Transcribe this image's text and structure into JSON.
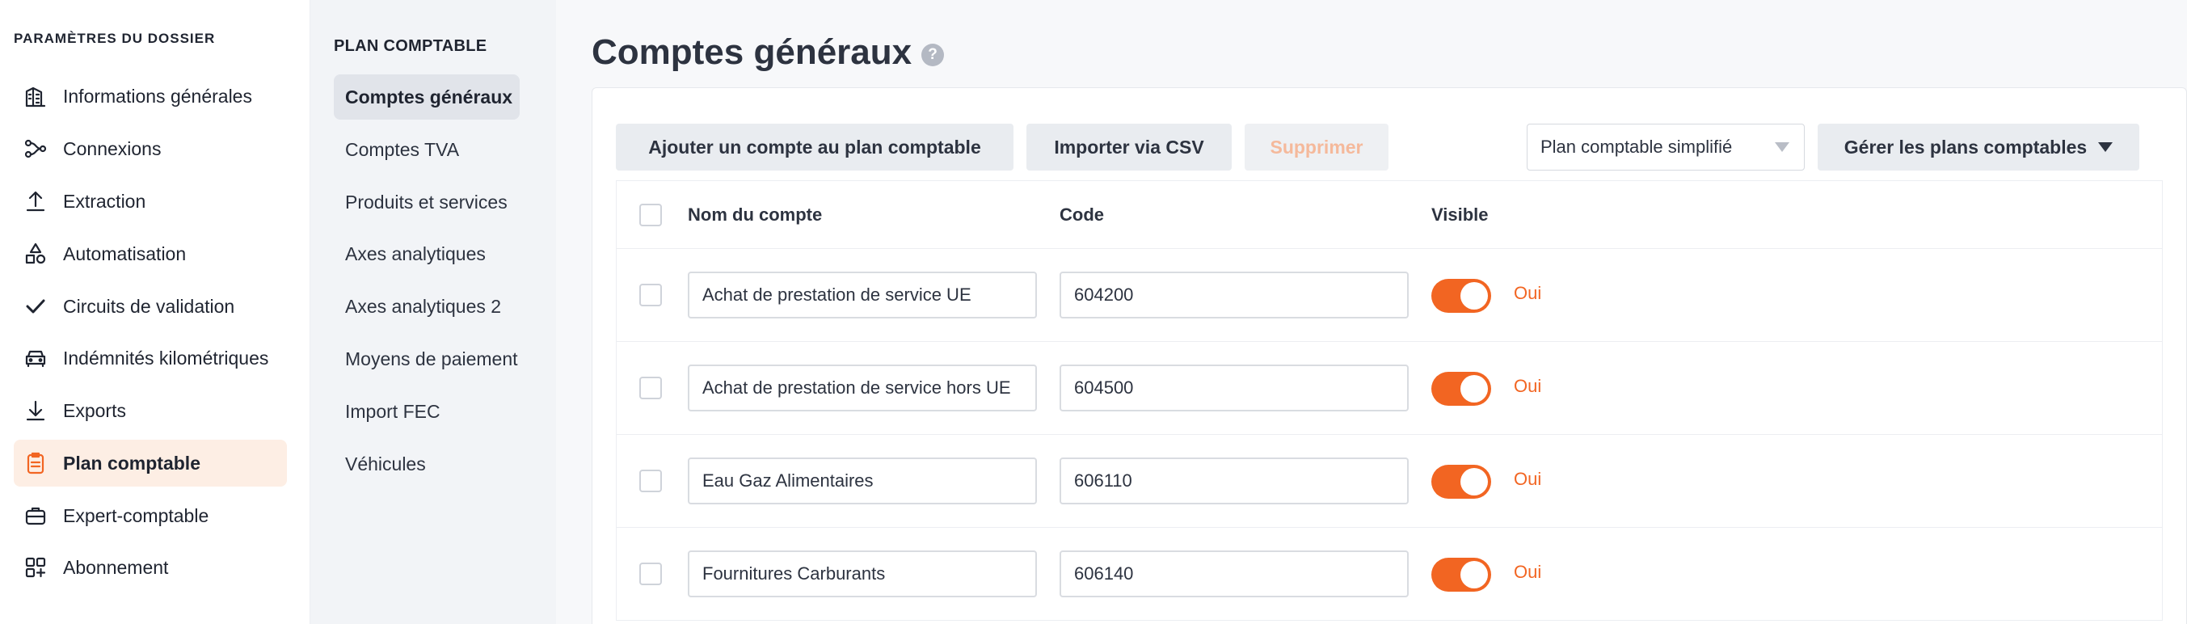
{
  "sidebar": {
    "title": "PARAMÈTRES DU DOSSIER",
    "items": [
      {
        "label": "Informations générales",
        "icon": "building-icon"
      },
      {
        "label": "Connexions",
        "icon": "connections-icon"
      },
      {
        "label": "Extraction",
        "icon": "upload-icon"
      },
      {
        "label": "Automatisation",
        "icon": "shapes-icon"
      },
      {
        "label": "Circuits de validation",
        "icon": "check-icon"
      },
      {
        "label": "Indémnités kilométriques",
        "icon": "car-icon"
      },
      {
        "label": "Exports",
        "icon": "download-icon"
      },
      {
        "label": "Plan comptable",
        "icon": "clipboard-icon",
        "active": true
      },
      {
        "label": "Expert-comptable",
        "icon": "briefcase-icon"
      },
      {
        "label": "Abonnement",
        "icon": "grid-plus-icon"
      }
    ]
  },
  "subnav": {
    "title": "PLAN COMPTABLE",
    "items": [
      {
        "label": "Comptes généraux",
        "active": true
      },
      {
        "label": "Comptes TVA"
      },
      {
        "label": "Produits et services"
      },
      {
        "label": "Axes analytiques"
      },
      {
        "label": "Axes analytiques 2"
      },
      {
        "label": "Moyens de paiement"
      },
      {
        "label": "Import FEC"
      },
      {
        "label": "Véhicules"
      }
    ]
  },
  "main": {
    "title": "Comptes généraux",
    "help": "?",
    "toolbar": {
      "add_label": "Ajouter un compte au plan comptable",
      "import_label": "Importer via CSV",
      "delete_label": "Supprimer",
      "plan_select_value": "Plan comptable simplifié",
      "manage_label": "Gérer les plans comptables"
    },
    "table": {
      "headers": {
        "name": "Nom du compte",
        "code": "Code",
        "visible": "Visible"
      },
      "rows": [
        {
          "name": "Achat de prestation de service UE",
          "code": "604200",
          "visible": "Oui"
        },
        {
          "name": "Achat de prestation de service hors UE",
          "code": "604500",
          "visible": "Oui"
        },
        {
          "name": "Eau Gaz Alimentaires",
          "code": "606110",
          "visible": "Oui"
        },
        {
          "name": "Fournitures Carburants",
          "code": "606140",
          "visible": "Oui"
        }
      ]
    }
  },
  "colors": {
    "accent": "#f26522",
    "active_bg": "#fdeee4"
  }
}
